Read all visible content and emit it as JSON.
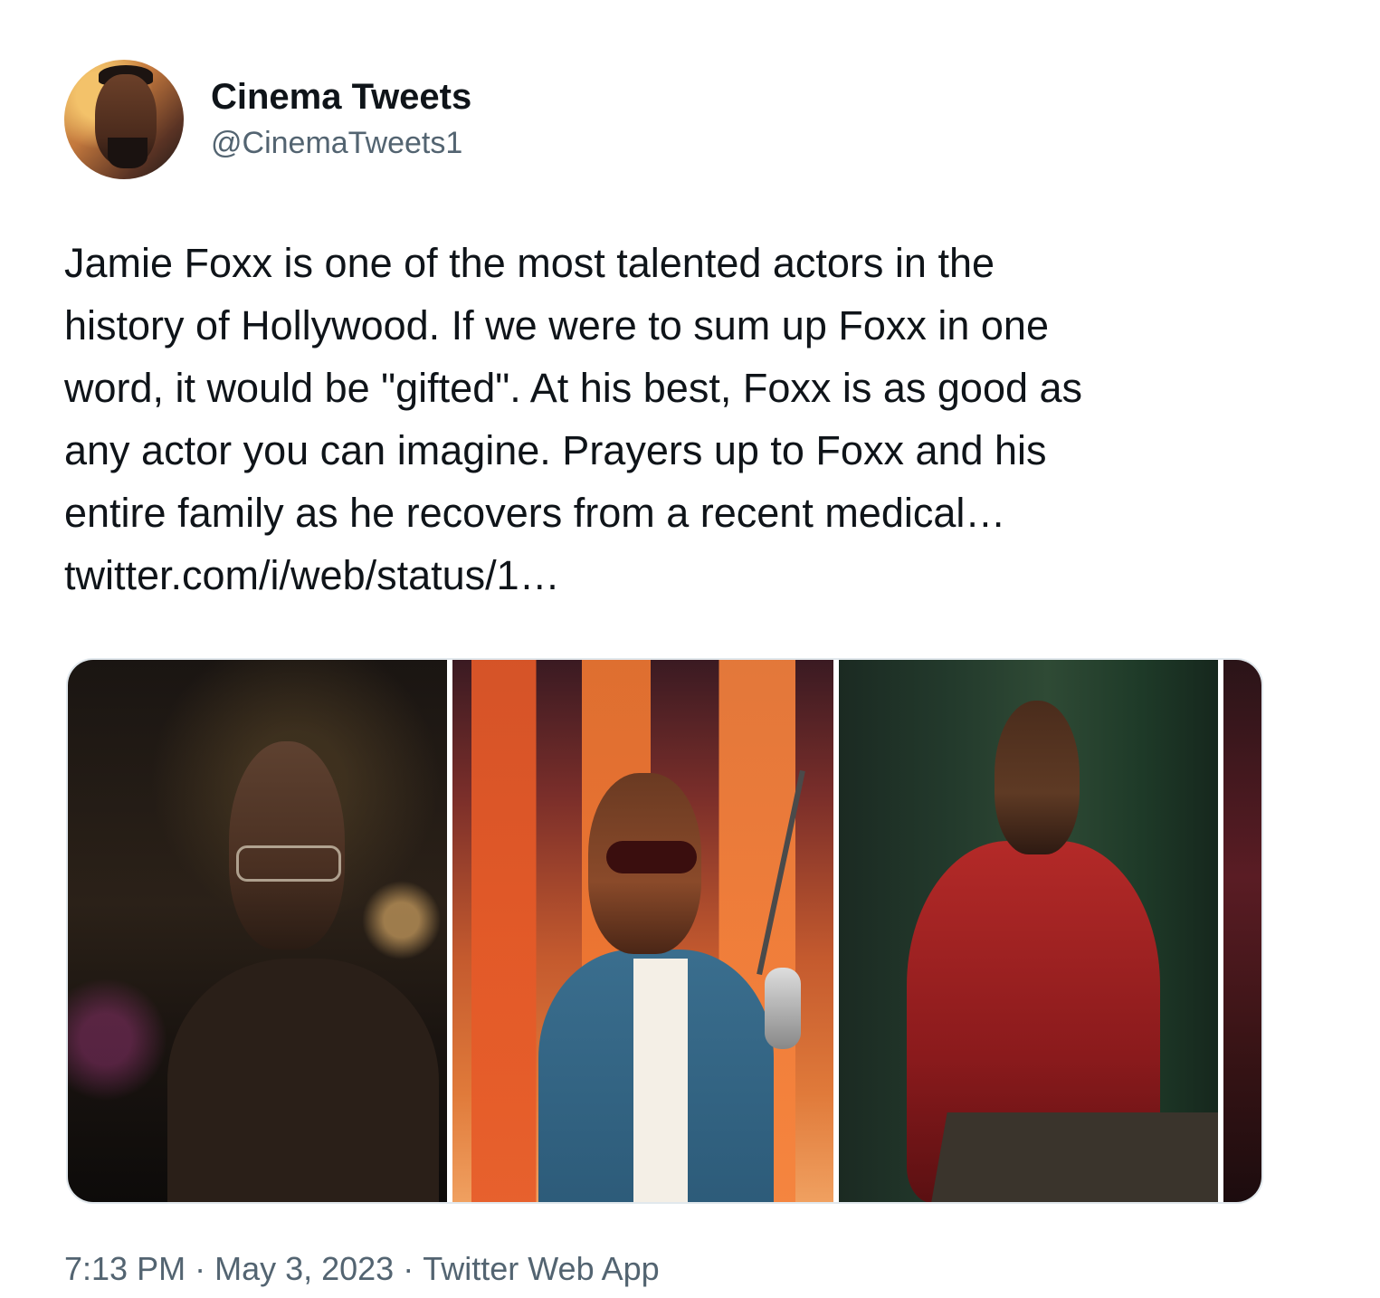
{
  "author": {
    "display_name": "Cinema Tweets",
    "handle": "@CinemaTweets1",
    "avatar_icon": "profile-photo"
  },
  "tweet": {
    "lines": [
      "Jamie Foxx is one of the most talented actors in the",
      "history of Hollywood. If we were to sum up Foxx in one",
      "word, it would be \"gifted\". At his best, Foxx is as good as",
      "any actor you can imagine. Prayers up to Foxx and his",
      "entire family as he recovers from a recent medical…",
      "twitter.com/i/web/status/1…"
    ]
  },
  "media": {
    "photo_count_visible": 4
  },
  "meta": {
    "time": "7:13 PM",
    "separator": "·",
    "date": "May 3, 2023",
    "source": "Twitter Web App"
  },
  "colors": {
    "text_primary": "#0f1419",
    "text_secondary": "#536471",
    "media_border": "#e1e8ed"
  }
}
